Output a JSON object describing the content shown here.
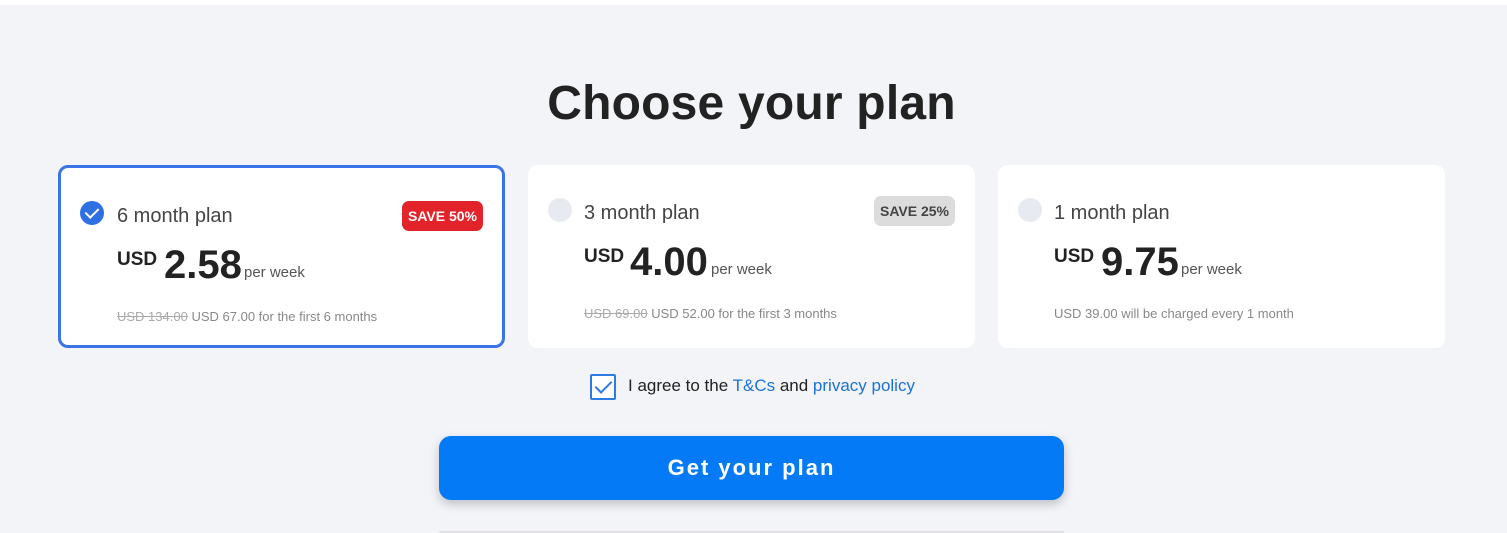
{
  "page": {
    "title": "Choose your plan"
  },
  "plans": [
    {
      "name": "6 month plan",
      "badge": "SAVE 50%",
      "currency": "USD",
      "price": "2.58",
      "period": "per week",
      "old_price": "USD 134.00",
      "note": "USD 67.00 for the first 6 months",
      "selected": true
    },
    {
      "name": "3 month plan",
      "badge": "SAVE 25%",
      "currency": "USD",
      "price": "4.00",
      "period": "per week",
      "old_price": "USD 69.00",
      "note": "USD 52.00 for the first 3 months",
      "selected": false
    },
    {
      "name": "1 month plan",
      "badge": "",
      "currency": "USD",
      "price": "9.75",
      "period": "per week",
      "old_price": "",
      "note": "USD 39.00 will be charged every 1 month",
      "selected": false
    }
  ],
  "agreement": {
    "checked": true,
    "prefix": "I agree to the ",
    "terms_link": "T&Cs",
    "middle": " and ",
    "privacy_link": "privacy policy"
  },
  "cta": {
    "label": "Get your plan"
  },
  "colors": {
    "accent": "#057af7",
    "selected_border": "#3b73e8",
    "badge_red": "#e2242a",
    "badge_grey": "#dcdcdc",
    "link": "#1a73d9",
    "background": "#f3f4f8"
  }
}
